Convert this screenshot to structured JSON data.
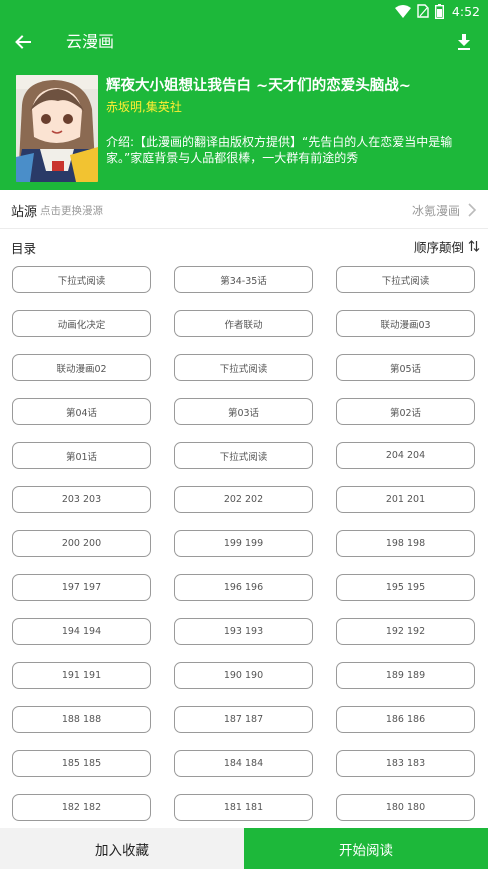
{
  "status_bar": {
    "time": "4:52"
  },
  "toolbar": {
    "title": "云漫画"
  },
  "comic": {
    "title": "辉夜大小姐想让我告白 ~天才们的恋爱头脑战~",
    "author": "赤坂明,集英社",
    "description": "介绍:【此漫画的翻译由版权方提供】“先告白的人在恋爱当中是输家。”家庭背景与人品都很棒，一大群有前途的秀"
  },
  "source": {
    "label": "站源",
    "hint": "点击更换漫源",
    "value": "冰氪漫画"
  },
  "catalog": {
    "label": "目录",
    "order_label": "顺序颠倒"
  },
  "chapters": [
    "下拉式阅读",
    "第34-35话",
    "下拉式阅读",
    "动画化决定",
    "作者联动",
    "联动漫画03",
    "联动漫画02",
    "下拉式阅读",
    "第05话",
    "第04话",
    "第03话",
    "第02话",
    "第01话",
    "下拉式阅读",
    "204 204",
    "203 203",
    "202 202",
    "201 201",
    "200 200",
    "199 199",
    "198 198",
    "197 197",
    "196 196",
    "195 195",
    "194 194",
    "193 193",
    "192 192",
    "191 191",
    "190 190",
    "189 189",
    "188 188",
    "187 187",
    "186 186",
    "185 185",
    "184 184",
    "183 183",
    "182 182",
    "181 181",
    "180 180"
  ],
  "bottom": {
    "favorite_label": "加入收藏",
    "read_label": "开始阅读"
  },
  "colors": {
    "primary": "#1db83a",
    "author": "#ffee33"
  },
  "icons": [
    "wifi-icon",
    "sim-icon",
    "battery-icon",
    "back-arrow-icon",
    "download-icon",
    "chevron-right-icon",
    "sort-icon"
  ]
}
